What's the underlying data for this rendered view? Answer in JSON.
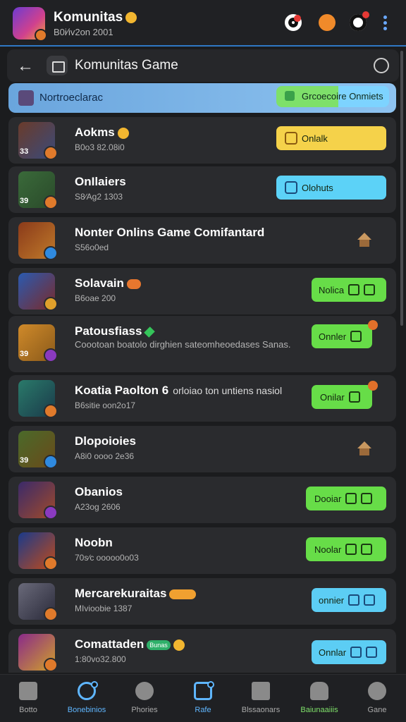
{
  "app": {
    "title": "Komunitas",
    "subtitle": "B0i∕iv2on 2001"
  },
  "header": {
    "title": "Komunitas Game"
  },
  "highlight": {
    "label": "Nortroeclarac",
    "button": "Grcoecoire Onmiets"
  },
  "rows": [
    {
      "title": "Aokms",
      "sub": "B0o3 82.08i0",
      "level": "33",
      "button": "Onlalk",
      "button_color": "#f5d24a"
    },
    {
      "title": "OnIlaiers",
      "sub": "S8∕Ag2 1303",
      "level": "39",
      "button": "Olohuts",
      "button_color": "#5cd2f7"
    },
    {
      "title": "Nonter Onlins Game Comifantard",
      "sub": "S56o0ed",
      "level": ""
    },
    {
      "title": "Solavain",
      "sub": "B6oae 200",
      "level": "",
      "button": "Nolica",
      "button_color": "#67dd48"
    },
    {
      "title": "Patousfiass",
      "sub": "Coootoan boatolo dirghien sateomheoedases Sanas.",
      "level": "39",
      "button": "Onnler",
      "button_color": "#67dd48"
    },
    {
      "title": "Koatia Paolton 6",
      "desc": "orloiao ton untiens nasiol",
      "sub": "B6sitie oon2o17",
      "level": "",
      "button": "Onilar",
      "button_color": "#67dd48"
    },
    {
      "title": "Dlopoioies",
      "sub": "A8i0 oooo 2e36",
      "level": "39",
      "sub2": ""
    },
    {
      "title": "Obanios",
      "sub": "A23og 2606",
      "level": "",
      "button": "Dooiar",
      "button_color": "#67dd48"
    },
    {
      "title": "Noobn",
      "sub": "70s∕c ooooo0o03",
      "level": "",
      "button": "Noolar",
      "button_color": "#67dd48"
    },
    {
      "title": "Mercarekuraitas",
      "sub": "MIvioobie 1387",
      "level": "",
      "button": "onnier",
      "button_color": "#5ccdf4"
    },
    {
      "title": "Comattaden",
      "tag": "Bunas",
      "sub": "1:80vo32.800",
      "level": "",
      "button": "Onnlar",
      "button_color": "#5ccdf4"
    }
  ],
  "bottom_nav": [
    {
      "label": "Botto",
      "icon": "home-icon",
      "color": "#aaaaaa"
    },
    {
      "label": "Bonebinios",
      "icon": "compass-icon",
      "color": "#5fb6ff"
    },
    {
      "label": "Phories",
      "icon": "rocket-icon",
      "color": "#aaaaaa"
    },
    {
      "label": "Rafe",
      "icon": "calendar-icon",
      "color": "#5fb6ff"
    },
    {
      "label": "Blssaonars",
      "icon": "book-icon",
      "color": "#aaaaaa"
    },
    {
      "label": "Baiunaaiiis",
      "icon": "controller-icon",
      "color": "#7fe06a"
    },
    {
      "label": "Gane",
      "icon": "profile-icon",
      "color": "#aaaaaa"
    }
  ]
}
